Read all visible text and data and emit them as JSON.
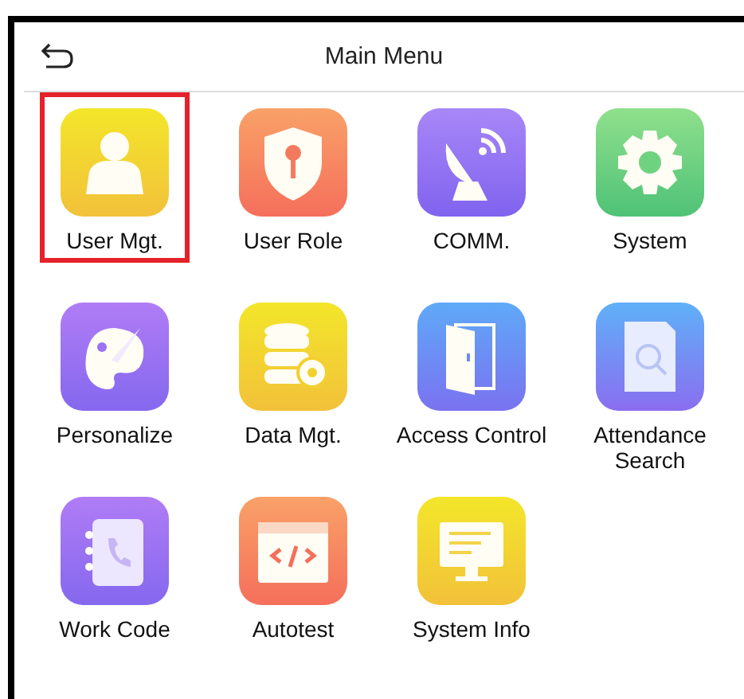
{
  "header": {
    "title": "Main Menu"
  },
  "menu_items": [
    {
      "label": "User Mgt.",
      "selected": true
    },
    {
      "label": "User Role",
      "selected": false
    },
    {
      "label": "COMM.",
      "selected": false
    },
    {
      "label": "System",
      "selected": false
    },
    {
      "label": "Personalize",
      "selected": false
    },
    {
      "label": "Data Mgt.",
      "selected": false
    },
    {
      "label": "Access Control",
      "selected": false
    },
    {
      "label": "Attendance\nSearch",
      "selected": false
    },
    {
      "label": "Work Code",
      "selected": false
    },
    {
      "label": "Autotest",
      "selected": false
    },
    {
      "label": "System Info",
      "selected": false
    }
  ]
}
